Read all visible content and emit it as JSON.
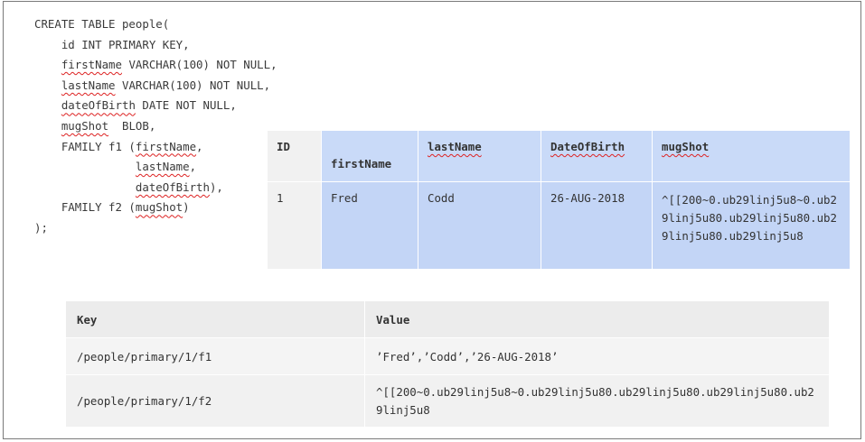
{
  "sql": {
    "line1": "CREATE TABLE people(",
    "line2": "    id INT PRIMARY KEY,",
    "line3_col": "firstName",
    "line3_rest": " VARCHAR(100) NOT NULL,",
    "line4_col": "lastName",
    "line4_rest": " VARCHAR(100) NOT NULL,",
    "line5_col": "dateOfBirth",
    "line5_rest": " DATE NOT NULL,",
    "line6_col": "mugShot",
    "line6_rest": "  BLOB,",
    "line7_pre": "    FAMILY f1 (",
    "line7_col": "firstName",
    "line7_rest": ",",
    "line8_col": "lastName",
    "line8_rest": ",",
    "line9_col": "dateOfBirth",
    "line9_rest": "),",
    "line10_pre": "    FAMILY f2 (",
    "line10_col": "mugShot",
    "line10_rest": ")",
    "line11": ");"
  },
  "people_table": {
    "headers": [
      "ID",
      "firstName",
      "lastName",
      "DateOfBirth",
      "mugShot"
    ],
    "row": [
      "1",
      "Fred",
      "Codd",
      "26-AUG-2018",
      "^[[200~0.ub29linj5u8~0.ub29linj5u80.ub29linj5u80.ub29linj5u80.ub29linj5u8"
    ]
  },
  "kv_table": {
    "headers": [
      "Key",
      "Value"
    ],
    "rows": [
      {
        "key": "/people/primary/1/f1",
        "value": "’Fred’,’Codd’,’26-AUG-2018’"
      },
      {
        "key": "/people/primary/1/f2",
        "value": "^[[200~0.ub29linj5u8~0.ub29linj5u80.ub29linj5u80.ub29linj5u80.ub29linj5u8"
      }
    ]
  }
}
